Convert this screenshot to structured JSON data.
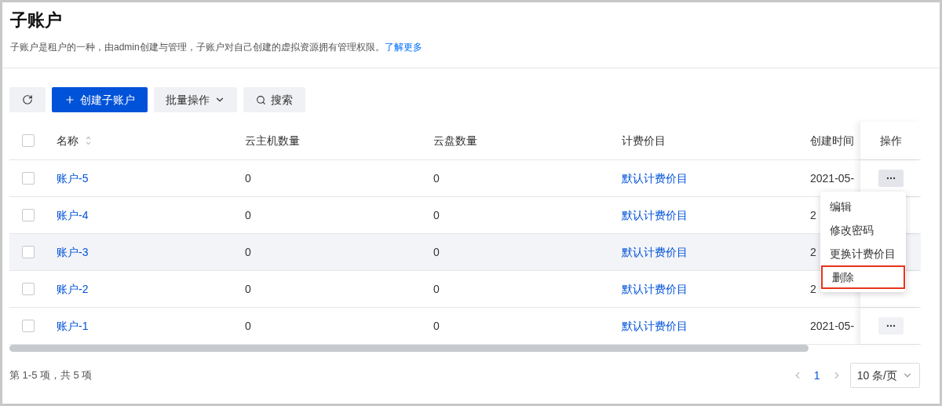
{
  "page": {
    "title": "子账户",
    "description": "子账户是租户的一种，由admin创建与管理，子账户对自己创建的虚拟资源拥有管理权限。",
    "learn_more": "了解更多"
  },
  "toolbar": {
    "create_button": "创建子账户",
    "batch_button": "批量操作",
    "search_button": "搜索"
  },
  "table": {
    "select_all_checked": false,
    "columns": [
      "名称",
      "云主机数量",
      "云盘数量",
      "计费价目",
      "创建时间",
      "操作"
    ],
    "rows": [
      {
        "name": "账户-5",
        "vms": "0",
        "disks": "0",
        "billing": "默认计费价目",
        "created": "2021-05-",
        "checked": false,
        "highlighted": false,
        "actions_visible": true
      },
      {
        "name": "账户-4",
        "vms": "0",
        "disks": "0",
        "billing": "默认计费价目",
        "created": "2",
        "checked": false,
        "highlighted": false,
        "actions_visible": false
      },
      {
        "name": "账户-3",
        "vms": "0",
        "disks": "0",
        "billing": "默认计费价目",
        "created": "2",
        "checked": false,
        "highlighted": true,
        "actions_visible": false
      },
      {
        "name": "账户-2",
        "vms": "0",
        "disks": "0",
        "billing": "默认计费价目",
        "created": "2",
        "checked": false,
        "highlighted": false,
        "actions_visible": false
      },
      {
        "name": "账户-1",
        "vms": "0",
        "disks": "0",
        "billing": "默认计费价目",
        "created": "2021-05-",
        "checked": false,
        "highlighted": false,
        "actions_visible": true
      }
    ]
  },
  "action_menu": {
    "items": [
      {
        "label": "编辑",
        "outlined": false
      },
      {
        "label": "修改密码",
        "outlined": false
      },
      {
        "label": "更换计费价目",
        "outlined": false
      },
      {
        "label": "删除",
        "outlined": true
      }
    ]
  },
  "footer": {
    "summary": "第 1-5 项，共 5 项",
    "pages": [
      {
        "label": "1",
        "selected": true
      }
    ],
    "page_size": "10 条/页"
  }
}
